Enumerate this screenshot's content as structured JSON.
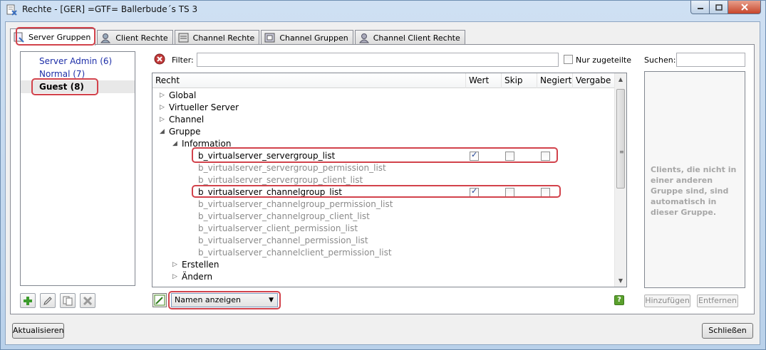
{
  "window": {
    "title": "Rechte - [GER] =GTF= Ballerbude´s TS 3",
    "min_label": "",
    "max_label": "",
    "close_label": "x"
  },
  "tabs": [
    {
      "label": "Server Gruppen",
      "active": true
    },
    {
      "label": "Client Rechte",
      "active": false
    },
    {
      "label": "Channel Rechte",
      "active": false
    },
    {
      "label": "Channel Gruppen",
      "active": false
    },
    {
      "label": "Channel Client Rechte",
      "active": false
    }
  ],
  "groups": [
    {
      "label": "Server Admin (6)",
      "selected": false
    },
    {
      "label": "Normal (7)",
      "selected": false
    },
    {
      "label": "Guest (8)",
      "selected": true
    }
  ],
  "filter": {
    "label": "Filter:",
    "value": "",
    "only_assigned_label": "Nur zugeteilte"
  },
  "tree": {
    "columns": [
      "Recht",
      "Wert",
      "Skip",
      "Negiert",
      "Vergabe"
    ],
    "rows": [
      {
        "label": "Global",
        "level": 0,
        "expander": "▷",
        "dim": false
      },
      {
        "label": "Virtueller Server",
        "level": 0,
        "expander": "▷",
        "dim": false
      },
      {
        "label": "Channel",
        "level": 0,
        "expander": "▷",
        "dim": false
      },
      {
        "label": "Gruppe",
        "level": 0,
        "expander": "◢",
        "dim": false
      },
      {
        "label": "Information",
        "level": 1,
        "expander": "◢",
        "dim": false
      },
      {
        "label": "b_virtualserver_servergroup_list",
        "level": 2,
        "expander": "",
        "dim": false,
        "wert": true,
        "skip": false,
        "negiert": false
      },
      {
        "label": "b_virtualserver_servergroup_permission_list",
        "level": 2,
        "expander": "",
        "dim": true
      },
      {
        "label": "b_virtualserver_servergroup_client_list",
        "level": 2,
        "expander": "",
        "dim": true
      },
      {
        "label": "b_virtualserver_channelgroup_list",
        "level": 2,
        "expander": "",
        "dim": false,
        "wert": true,
        "skip": false,
        "negiert": false
      },
      {
        "label": "b_virtualserver_channelgroup_permission_list",
        "level": 2,
        "expander": "",
        "dim": true
      },
      {
        "label": "b_virtualserver_channelgroup_client_list",
        "level": 2,
        "expander": "",
        "dim": true
      },
      {
        "label": "b_virtualserver_client_permission_list",
        "level": 2,
        "expander": "",
        "dim": true
      },
      {
        "label": "b_virtualserver_channel_permission_list",
        "level": 2,
        "expander": "",
        "dim": true
      },
      {
        "label": "b_virtualserver_channelclient_permission_list",
        "level": 2,
        "expander": "",
        "dim": true
      },
      {
        "label": "Erstellen",
        "level": 1,
        "expander": "▷",
        "dim": false
      },
      {
        "label": "Ändern",
        "level": 1,
        "expander": "▷",
        "dim": false
      }
    ]
  },
  "view_mode": {
    "selected": "Namen anzeigen"
  },
  "help": {
    "label": "?"
  },
  "search": {
    "label": "Suchen:",
    "value": ""
  },
  "clients": {
    "note": "Clients, die nicht in einer anderen Gruppe sind, sind automatisch in dieser Gruppe.",
    "add_label": "Hinzufügen",
    "remove_label": "Entfernen"
  },
  "footer": {
    "refresh_label": "Aktualisieren",
    "close_label": "Schließen"
  },
  "colors": {
    "highlight": "#d2424b",
    "group_link": "#1d2ea8",
    "dim_text": "#8b8b8b"
  }
}
